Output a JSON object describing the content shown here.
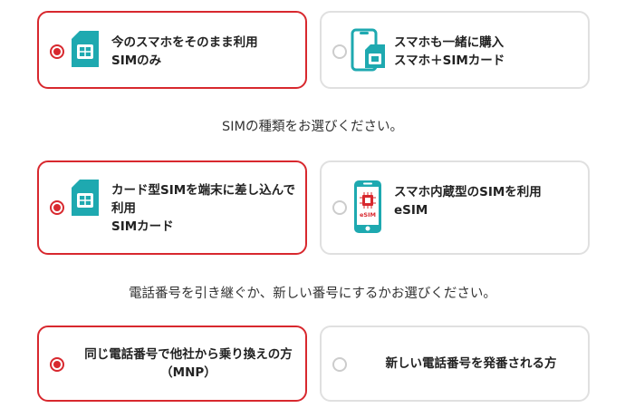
{
  "colors": {
    "accent": "#d8282e",
    "teal": "#1ea9b0",
    "border": "#e0e0e0"
  },
  "section1": {
    "options": [
      {
        "lines": [
          "今のスマホをそのまま利用",
          "SIMのみ"
        ],
        "icon": "sim-card-icon",
        "selected": true
      },
      {
        "lines": [
          "スマホも一緒に購入",
          "スマホ＋SIMカード"
        ],
        "icon": "phone-with-sim-icon",
        "selected": false
      }
    ]
  },
  "section2": {
    "caption": "SIMの種類をお選びください。",
    "options": [
      {
        "lines": [
          "カード型SIMを端末に差し込んで",
          "利用",
          "SIMカード"
        ],
        "icon": "sim-card-icon",
        "selected": true
      },
      {
        "lines": [
          "スマホ内蔵型のSIMを利用",
          "eSIM"
        ],
        "icon": "esim-phone-icon",
        "chip_label": "eSIM",
        "selected": false
      }
    ]
  },
  "section3": {
    "caption": "電話番号を引き継ぐか、新しい番号にするかお選びください。",
    "options": [
      {
        "lines": [
          "同じ電話番号で他社から乗り換えの方",
          "（MNP）"
        ],
        "selected": true
      },
      {
        "lines": [
          "新しい電話番号を発番される方"
        ],
        "selected": false
      }
    ]
  }
}
